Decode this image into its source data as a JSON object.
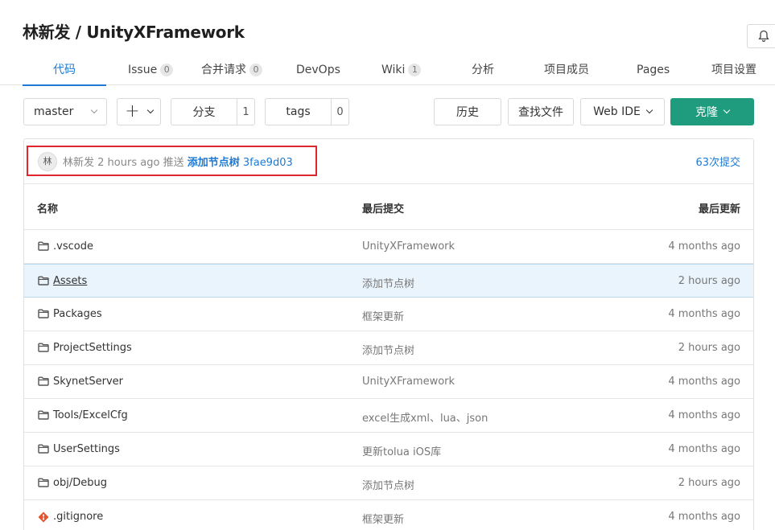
{
  "header": {
    "title": "林新发 / UnityXFramework"
  },
  "tabs": [
    {
      "label": "代码",
      "active": true
    },
    {
      "label": "Issue",
      "badge": "0"
    },
    {
      "label": "合并请求",
      "badge": "0"
    },
    {
      "label": "DevOps"
    },
    {
      "label": "Wiki",
      "badge": "1"
    },
    {
      "label": "分析"
    },
    {
      "label": "项目成员"
    },
    {
      "label": "Pages"
    },
    {
      "label": "项目设置"
    }
  ],
  "toolbar": {
    "branch": "master",
    "add": "+",
    "branches_label": "分支",
    "branches_count": "1",
    "tags_label": "tags",
    "tags_count": "0",
    "history": "历史",
    "find_file": "查找文件",
    "web_ide": "Web IDE",
    "clone": "克隆"
  },
  "last_commit": {
    "avatar": "林",
    "author": "林新发",
    "time": "2 hours ago",
    "action": "推送",
    "message": "添加节点树",
    "sha": "3fae9d03",
    "count": "63次提交"
  },
  "table": {
    "headers": {
      "name": "名称",
      "commit": "最后提交",
      "updated": "最后更新"
    },
    "rows": [
      {
        "name": ".vscode",
        "type": "folder",
        "commit": "UnityXFramework",
        "updated": "4 months ago"
      },
      {
        "name": "Assets",
        "type": "folder",
        "commit": "添加节点树",
        "updated": "2 hours ago",
        "hovered": true
      },
      {
        "name": "Packages",
        "type": "folder",
        "commit": "框架更新",
        "updated": "4 months ago"
      },
      {
        "name": "ProjectSettings",
        "type": "folder",
        "commit": "添加节点树",
        "updated": "2 hours ago"
      },
      {
        "name": "SkynetServer",
        "type": "folder",
        "commit": "UnityXFramework",
        "updated": "4 months ago"
      },
      {
        "name": "Tools/ExcelCfg",
        "type": "folder",
        "commit": "excel生成xml、lua、json",
        "updated": "4 months ago"
      },
      {
        "name": "UserSettings",
        "type": "folder",
        "commit": "更新tolua iOS库",
        "updated": "4 months ago"
      },
      {
        "name": "obj/Debug",
        "type": "folder",
        "commit": "添加节点树",
        "updated": "2 hours ago"
      },
      {
        "name": ".gitignore",
        "type": "git-file",
        "commit": "框架更新",
        "updated": "4 months ago"
      }
    ]
  },
  "colors": {
    "accent": "#1e7ad3",
    "primary_button": "#1f9c7e",
    "highlight_box": "#e0272e"
  }
}
